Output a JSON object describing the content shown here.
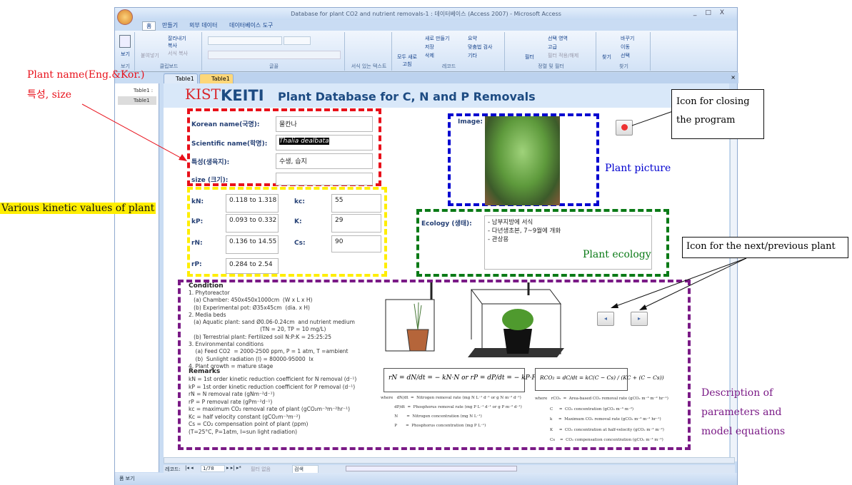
{
  "window": {
    "title": "Database for plant CO2 and nutrient removals-1 : 데이터베이스 (Access 2007) - Microsoft Access",
    "controls": [
      "_",
      "□",
      "X"
    ]
  },
  "ribbon": {
    "tabs": [
      "홈",
      "만들기",
      "외부 데이터",
      "데이터베이스 도구"
    ],
    "groups": [
      {
        "label": "보기",
        "items": [
          "보기"
        ]
      },
      {
        "label": "클립보드",
        "items": [
          "잘라내기",
          "복사",
          "서식 복사",
          "붙여넣기"
        ]
      },
      {
        "label": "글꼴",
        "items": []
      },
      {
        "label": "서식 있는 텍스트",
        "items": []
      },
      {
        "label": "레코드",
        "items": [
          "모두 새로 고침",
          "새로 만들기",
          "저장",
          "삭제",
          "요약",
          "맞춤법 검사",
          "기타"
        ]
      },
      {
        "label": "정렬 및 필터",
        "items": [
          "필터",
          "선택 영역",
          "고급",
          "필터 적용/해제"
        ]
      },
      {
        "label": "찾기",
        "items": [
          "찾기",
          "바꾸기",
          "이동",
          "선택"
        ]
      }
    ]
  },
  "doc_tabs": [
    "Table1",
    "Table1"
  ],
  "nav_pane": [
    "Table1 :",
    "Table1"
  ],
  "form": {
    "header_title": "Plant Database for C, N and P Removals",
    "logos": [
      "KIST",
      "KEITI"
    ],
    "fields": [
      {
        "label": "Korean name(국명):",
        "value": "물칸나"
      },
      {
        "label": "Scientific name(학명):",
        "value": "Thalia dealbata"
      },
      {
        "label": "특성(생육지):",
        "value": "수생, 습지"
      },
      {
        "label": "size (크기):",
        "value": ""
      }
    ],
    "kinetics": [
      {
        "label": "kN:",
        "value": "0.118 to 1.318"
      },
      {
        "label": "kP:",
        "value": "0.093 to 0.332"
      },
      {
        "label": "rN:",
        "value": "0.136 to 14.55"
      },
      {
        "label": "rP:",
        "value": "0.284 to 2.54"
      },
      {
        "label": "kc:",
        "value": "55"
      },
      {
        "label": "K:",
        "value": "29"
      },
      {
        "label": "Cs:",
        "value": "90"
      }
    ],
    "image_label": "Image:",
    "ecology_label": "Ecology (생태):",
    "ecology_value": "- 남부지방에 서식\n- 다년생초본, 7~9월에 개화\n- 관상용",
    "condition_title": "Condition",
    "condition_text": "1. Phytoreactor\n   (a) Chamber: 450x450x1000cm  (W x L x H)\n   (b) Experimental pot: Ø35x45cm  (dia. x H)\n2. Media beds\n   (a) Aquatic plant: sand Ø0.06-0.24cm  and nutrient medium\n                                          (TN = 20, TP = 10 mg/L)\n   (b) Terrestrial plant: Fertilized soil N:P:K = 25:25:25\n3. Environmental conditions\n    (a) Feed CO2  = 2000-2500 ppm, P = 1 atm, T =ambient\n    (b)  Sunlight radiation (I) = 80000-95000  lx\n4. Plant growth = mature stage",
    "remarks_title": "Remarks",
    "remarks_text": "kN = 1st order kinetic reduction coefficient for N removal (d⁻¹)\nkP = 1st order kinetic reduction coefficient for P removal (d⁻¹)\nrN = N removal rate (gNm⁻²d⁻¹)\nrP = P removal rate (gPm⁻²d⁻¹)\nkc = maximum CO₂ removal rate of plant (gCO₂m⁻³m⁻²hr⁻¹)\nKc = half velocity constant (gCO₂m⁻³m⁻²)\nCs = CO₂ compensation point of plant (ppm)\n(T=25°C, P=1atm, I=sun light radiation)",
    "eq1": "rN = dN/dt  =  − kN·N   or   rP = dP/dt  =  − kP·P",
    "eq1_where": "where   dN/dt  =  Nitrogen removal rate (mg N L⁻¹ d⁻¹ or g N m⁻² d⁻¹)\n           dP/dt  =  Phosphorus removal rate (mg P L⁻¹ d⁻¹ or g P m⁻² d⁻¹)\n           N       =  Nitrogen concentration (mg N L⁻¹)\n           P       =  Phosphorus concentration (mg P L⁻¹)",
    "eq2": "RCO₂ = dC/dt = kC(C − Cs) / (KC + (C − Cs))",
    "eq2_where": "where   rCO₂  =  Area-based CO₂ removal rate (gCO₂ m⁻³ m⁻² hr⁻¹)\n            C     =  CO₂ concentration (gCO₂ m⁻³ m⁻²)\n            k     =  Maximum CO₂ removal rate (gCO₂ m⁻³ m⁻² hr⁻¹)\n            K     =  CO₂ concentration at half-velocity (gCO₂ m⁻³ m⁻²)\n            Cs    =  CO₂ compensation concentration (gCO₂ m⁻³ m⁻²)"
  },
  "record_nav": {
    "label": "레코드:",
    "position": "1/78",
    "filter": "필터 없음",
    "search": "검색"
  },
  "status": {
    "text": "폼 보기"
  },
  "annotations": {
    "plant_name": "Plant name(Eng.&Kor.)",
    "plant_name2": "특성, size",
    "kinetic": "Various kinetic values of plant",
    "closing": "Icon for closing the program",
    "picture": "Plant picture",
    "next_prev": "Icon for the next/previous plant",
    "ecology": "Plant ecology",
    "description": "Description of parameters and model equations"
  },
  "colors": {
    "red": "#e8101a",
    "yellow": "#ffee00",
    "blue": "#0000d0",
    "green": "#0a7a16",
    "purple": "#7a1a86"
  }
}
